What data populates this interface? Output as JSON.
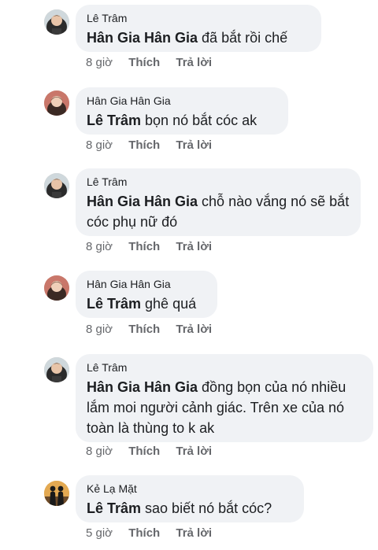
{
  "comments": [
    {
      "author": "Lê Trâm",
      "mention": "Hân Gia Hân Gia",
      "text": " đã bắt rồi chế",
      "time": "8 giờ",
      "like": "Thích",
      "reply": "Trả lời",
      "avatar": "female-profile-avatar"
    },
    {
      "author": "Hân Gia Hân Gia",
      "mention": "Lê Trâm",
      "text": " bọn nó bắt cóc ak",
      "time": "8 giờ",
      "like": "Thích",
      "reply": "Trả lời",
      "avatar": "female-profile-avatar"
    },
    {
      "author": "Lê Trâm",
      "mention": "Hân Gia Hân Gia",
      "text": " chỗ nào vắng nó sẽ bắt cóc phụ nữ đó",
      "time": "8 giờ",
      "like": "Thích",
      "reply": "Trả lời",
      "avatar": "female-profile-avatar"
    },
    {
      "author": "Hân Gia Hân Gia",
      "mention": "Lê Trâm",
      "text": " ghê quá",
      "time": "8 giờ",
      "like": "Thích",
      "reply": "Trả lời",
      "avatar": "female-profile-avatar"
    },
    {
      "author": "Lê Trâm",
      "mention": "Hân Gia Hân Gia",
      "text": " đồng bọn của nó nhiều lắm moi người cảnh giác. Trên xe của nó toàn là thùng to k ak",
      "time": "8 giờ",
      "like": "Thích",
      "reply": "Trả lời",
      "avatar": "female-profile-avatar"
    },
    {
      "author": "Kẻ Lạ Mặt",
      "mention": "Lê Trâm",
      "text": " sao biết nó bắt cóc?",
      "time": "5 giờ",
      "like": "Thích",
      "reply": "Trả lời",
      "avatar": "silhouette-avatar"
    }
  ]
}
